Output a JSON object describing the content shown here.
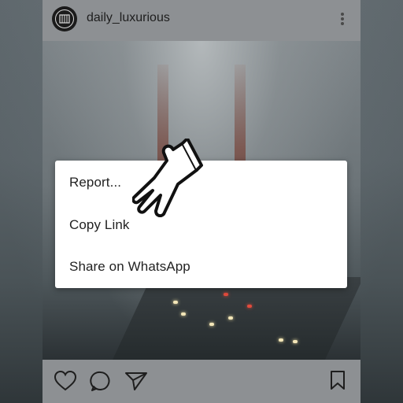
{
  "post": {
    "username": "daily_luxurious"
  },
  "context_menu": {
    "items": [
      {
        "label": "Report..."
      },
      {
        "label": "Copy Link"
      },
      {
        "label": "Share on WhatsApp"
      }
    ]
  },
  "icons": {
    "avatar": "avatar-logo-icon",
    "more": "more-vertical-icon",
    "like": "heart-icon",
    "comment": "comment-icon",
    "share": "send-icon",
    "save": "bookmark-icon",
    "cursor": "hand-pointer-icon"
  },
  "colors": {
    "menu_background": "#ffffff",
    "text": "#222222",
    "overlay": "#8d9093"
  }
}
